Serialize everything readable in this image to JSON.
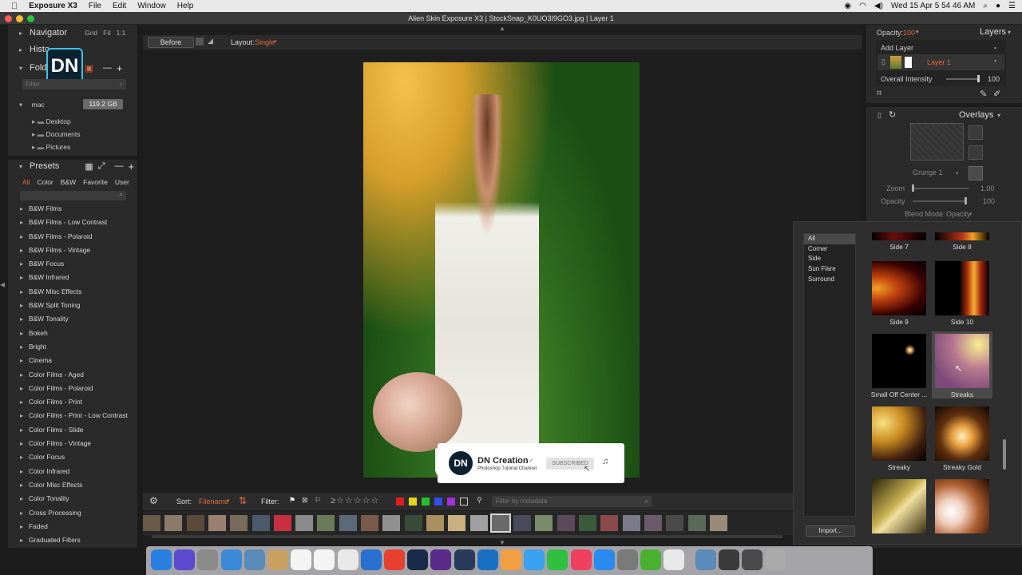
{
  "menubar": {
    "app": "Exposure X3",
    "items": [
      "File",
      "Edit",
      "Window",
      "Help"
    ],
    "clock": "Wed 15 Apr  5 54 46 AM"
  },
  "window": {
    "title": "Alien Skin Exposure X3 | StockSnap_K0UO3I9GO3.jpg | Layer 1"
  },
  "left": {
    "navigator": "Navigator",
    "nav_tabs": [
      "Grid",
      "Fit",
      "1:1"
    ],
    "history": "Histo",
    "folders": "Fold",
    "filter_placeholder": "Filter",
    "drive": "mac",
    "drive_size": "119.2 GB",
    "folders_list": [
      "Desktop",
      "Documents",
      "Pictures"
    ],
    "presets_title": "Presets",
    "preset_tabs": [
      "All",
      "Color",
      "B&W",
      "Favorite",
      "User"
    ],
    "presets": [
      "B&W Films",
      "B&W Films - Low Contrast",
      "B&W Films - Polaroid",
      "B&W Films - Vintage",
      "B&W Focus",
      "B&W Infrared",
      "B&W Misc Effects",
      "B&W Split Toning",
      "B&W Tonality",
      "Bokeh",
      "Bright",
      "Cinema",
      "Color Films - Aged",
      "Color Films - Polaroid",
      "Color Films - Print",
      "Color Films - Print - Low Contrast",
      "Color Films - Slide",
      "Color Films - Vintage",
      "Color Focus",
      "Color Infrared",
      "Color Misc Effects",
      "Color Tonality",
      "Cross Processing",
      "Faded",
      "Graduated Filters"
    ]
  },
  "toolbar": {
    "before": "Before",
    "layout_label": "Layout:",
    "layout_value": "Single"
  },
  "bottom": {
    "sort_label": "Sort:",
    "sort_value": "Filename",
    "filter_label": "Filter:",
    "metadata_placeholder": "Filter by metadata"
  },
  "right": {
    "opacity_label": "Opacity:",
    "opacity_value": "100",
    "layers_title": "Layers",
    "add_layer": "Add Layer",
    "layer_name": "Layer 1",
    "overall_intensity": "Overall Intensity",
    "overall_value": "100",
    "overlays_title": "Overlays",
    "overlay_name": "Grunge 1",
    "zoom_label": "Zoom",
    "zoom_value": "1.00",
    "opacity2_label": "Opacity",
    "opacity2_value": "100",
    "blend_label": "Blend Mode:",
    "blend_value": "Opacity"
  },
  "overlay_popup": {
    "categories": [
      "All",
      "Corner",
      "Side",
      "Sun Flare",
      "Surround"
    ],
    "thumbs": [
      "Side 7",
      "Side 8",
      "Side 9",
      "Side 10",
      "Small Off Center ...",
      "Streaks",
      "Streaky",
      "Streaky Gold"
    ],
    "import": "Import..."
  },
  "subscribe": {
    "channel": "DN Creation",
    "tagline": "Photoshop Tutorial Channel",
    "button": "SUBSCRIBED"
  },
  "logo": "DN",
  "colors": {
    "accent": "#e2683c",
    "panel": "#2a2a2a",
    "selected": "#4a4a4a"
  }
}
